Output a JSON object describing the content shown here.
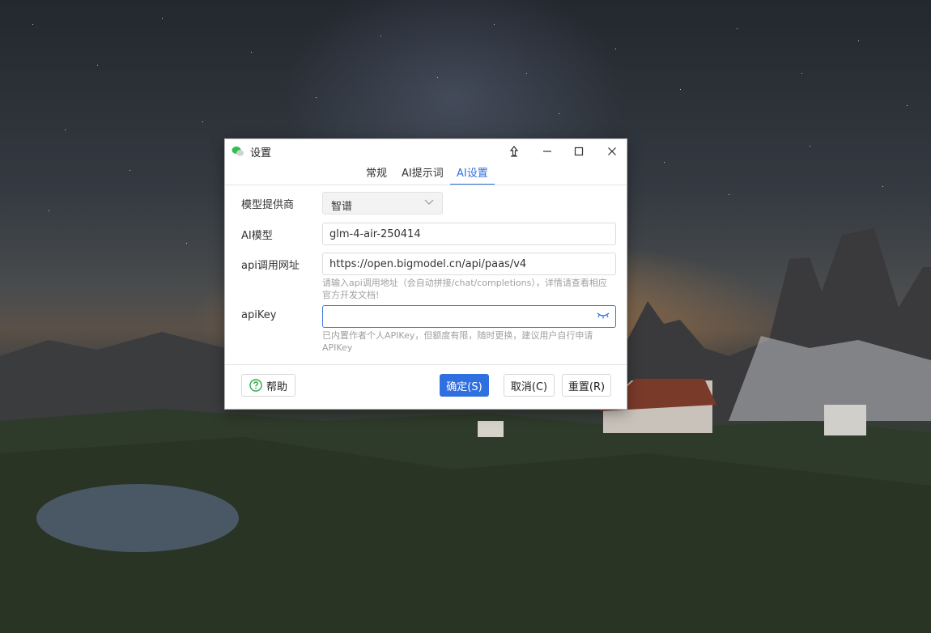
{
  "window": {
    "title": "设置"
  },
  "tabs": [
    {
      "label": "常规"
    },
    {
      "label": "AI提示词"
    },
    {
      "label": "AI设置"
    }
  ],
  "active_tab": "AI设置",
  "form": {
    "provider": {
      "label": "模型提供商",
      "value": "智谱"
    },
    "model": {
      "label": "AI模型",
      "value": "glm-4-air-250414"
    },
    "api_url": {
      "label": "api调用网址",
      "value": "https://open.bigmodel.cn/api/paas/v4",
      "hint": "请输入api调用地址（会自动拼接/chat/completions），详情请查看相应官方开发文档!"
    },
    "api_key": {
      "label": "apiKey",
      "value": "",
      "hint": "已内置作者个人APIKey，但额度有限，随时更换，建议用户自行申请APIKey"
    }
  },
  "footer": {
    "help_label": "帮助",
    "confirm_label": "确定(S)",
    "cancel_label": "取消(C)",
    "reset_label": "重置(R)"
  },
  "colors": {
    "accent": "#2f6fe0",
    "hint_text": "#a0a0a0"
  },
  "icons": [
    "app-chat-icon",
    "pin-icon",
    "minimize-icon",
    "maximize-icon",
    "close-icon",
    "chevron-down-icon",
    "eye-closed-icon",
    "help-circle-icon"
  ]
}
